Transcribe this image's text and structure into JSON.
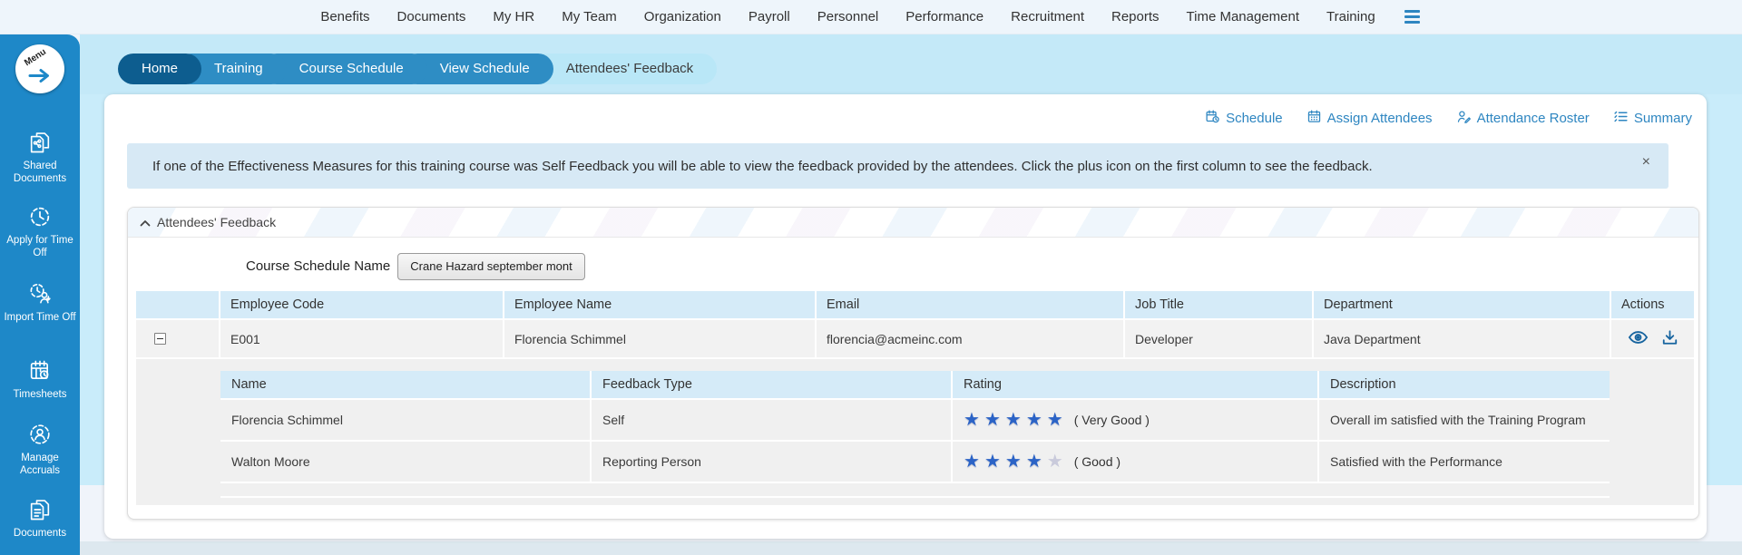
{
  "nav": {
    "items": [
      "Benefits",
      "Documents",
      "My HR",
      "My Team",
      "Organization",
      "Payroll",
      "Personnel",
      "Performance",
      "Recruitment",
      "Reports",
      "Time Management",
      "Training"
    ]
  },
  "sidebar": {
    "menu_label": "Menu",
    "items": [
      {
        "label": "Shared Documents",
        "icon": "shared-documents-icon"
      },
      {
        "label": "Apply for Time Off",
        "icon": "clock-icon"
      },
      {
        "label": "Import Time Off",
        "icon": "import-clock-person-icon"
      },
      {
        "label": "Timesheets",
        "icon": "calendar-clock-icon"
      },
      {
        "label": "Manage Accruals",
        "icon": "gear-person-icon"
      },
      {
        "label": "Documents",
        "icon": "documents-icon"
      }
    ]
  },
  "tabs": [
    {
      "label": "Home",
      "active": false
    },
    {
      "label": "Training",
      "active": false
    },
    {
      "label": "Course Schedule",
      "active": false
    },
    {
      "label": "View Schedule",
      "active": false
    },
    {
      "label": "Attendees' Feedback",
      "active": true
    }
  ],
  "toolbar": {
    "links": [
      {
        "label": "Schedule",
        "icon": "calendar-clock-icon"
      },
      {
        "label": "Assign Attendees",
        "icon": "calendar-icon"
      },
      {
        "label": "Attendance Roster",
        "icon": "person-pen-icon"
      },
      {
        "label": "Summary",
        "icon": "list-icon"
      }
    ]
  },
  "banner": {
    "text": "If one of the Effectiveness Measures for this training course was Self Feedback you will be able to view the feedback provided by the attendees. Click the plus icon on the first column to see the feedback.",
    "close": "×"
  },
  "panel": {
    "title": "Attendees' Feedback"
  },
  "form": {
    "course_schedule_label": "Course Schedule Name",
    "course_schedule_value": "Crane Hazard september mont"
  },
  "table": {
    "headers": [
      "",
      "Employee Code",
      "Employee Name",
      "Email",
      "Job Title",
      "Department",
      "Actions"
    ],
    "rows": [
      {
        "code": "E001",
        "name": "Florencia Schimmel",
        "email": "florencia@acmeinc.com",
        "job_title": "Developer",
        "department": "Java Department",
        "expanded": true
      }
    ]
  },
  "feedback": {
    "headers": [
      "Name",
      "Feedback Type",
      "Rating",
      "Description"
    ],
    "rows": [
      {
        "name": "Florencia Schimmel",
        "feedback_type": "Self",
        "stars": 5,
        "max_stars": 5,
        "rating_label": "( Very Good )",
        "description": "Overall im satisfied with the Training Program"
      },
      {
        "name": "Walton Moore",
        "feedback_type": "Reporting Person",
        "stars": 4,
        "max_stars": 5,
        "rating_label": "( Good )",
        "description": "Satisfied with the Performance"
      }
    ]
  },
  "colors": {
    "accent_blue": "#2e86c1",
    "sidebar_blue": "#1e88c8",
    "dark_tab": "#0d5d8f",
    "tab_blue": "#2e8dc4",
    "active_tab_bg": "#b9e7f7",
    "table_header_bg": "#d5ebf8",
    "banner_bg": "#d7e9f5",
    "star_filled": "#2b63c6",
    "star_empty": "#c9cadb"
  }
}
